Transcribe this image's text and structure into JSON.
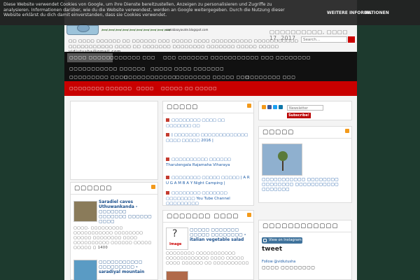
{
  "cookie": {
    "text": "Diese Website verwendet Cookies von Google, um ihre Dienste bereitzustellen, Anzeigen zu personalisieren und Zugriffe zu analysieren. Informationen darüber, wie du die Website verwendest, werden an Google weitergegeben. Durch die Nutzung dieser Website erklärst du dich damit einverstanden, dass sie Cookies verwendet.",
    "more_label": "WEITERE INFORMATIONEN",
    "ok_label": "OK"
  },
  "header": {
    "blog_title": "ꟷꟷꟷꟷꟷꟷꟷꟷꟷꟷ",
    "blog_url": "samabaayavate.blogspot.com",
    "date": "▢▢▢▢▢▢▢▢▢▢, ▢▢▢▢ 17, 2017",
    "search_placeholder": "Search...",
    "tagline": "▢▢ ▢▢▢▢ ▢▢▢▢▢▢ ▢▢ ▢▢▢▢▢▢ ▢▢▢ ▢▢▢▢▢ ▢▢▢▢ ▢▢▢▢▢▢▢▢▢▢ ▢▢▢▢▢▢▢▢▢▢▢ ▢▢▢▢▢▢▢▢▢▢▢ ▢▢▢▢ ▢▢ ▢▢▢▢▢▢▢ ▢▢▢▢▢▢▢▢ ▢▢▢▢▢▢▢ ▢▢▢▢▢ ▢▢▢▢▢ vidiutusha@gmail.com"
  },
  "nav": {
    "row1": [
      "▢▢▢▢ ▢▢▢▢▢",
      "▢▢▢▢▢▢▢ ▢▢▢",
      "▢▢▢ ▢▢▢▢▢▢▢ ▢▢▢▢▢▢▢",
      "▢▢▢▢ ▢▢▢ ▢▢▢▢▢▢▢▢"
    ],
    "row2": [
      "▢▢▢▢▢▢▢▢▢▢▢ ▢▢▢▢▢▢",
      "▢▢▢▢▢ ▢▢▢▢ ▢▢▢▢▢▢▢"
    ],
    "row3": [
      "▢▢▢▢▢▢▢▢▢ ▢▢▢▢",
      "▢▢▢▢▢▢▢▢▢▢▢▢",
      "▢▢▢▢▢▢▢▢ ▢▢▢▢▢ ▢▢▢",
      "▢▢▢▢▢▢▢▢ ▢▢▢"
    ],
    "row4": [
      "▢▢▢▢▢▢▢▢",
      "▢▢▢▢▢▢",
      "▢▢▢▢",
      "▢▢▢▢▢ ▢▢ ▢▢▢▢▢"
    ]
  },
  "left": {
    "heading": "▢▢▢▢▢▢",
    "posts": [
      {
        "title": "Saradiel caves Uthuwankanda - ▢▢▢▢▢▢▢ ▢▢▢▢▢▢▢ ▢▢▢▢▢▢ ▢▢▢▢",
        "text": "▢▢▢▢. ▢▢▢▢▢▢▢▢▢ ▢▢▢▢▢▢▢▢▢▢▢ ▢▢▢▢▢▢▢▢ ▢▢▢▢▢ ▢▢▢▢▢▢▢▢ ▢▢▢▢ ▢▢▢▢▢▢▢▢▢▢ ▢▢▢▢▢▢ ▢▢▢▢▢ ▢▢▢▢▢ ▢ 1400"
      },
      {
        "title": "▢▢▢▢▢▢▢▢▢▢▢ ▢▢▢▢▢▢▢▢▢ - saradiyal mountain",
        "text": ""
      }
    ]
  },
  "middle": {
    "heading": "▢▢▢▢▢",
    "items": [
      "▢▢▢▢▢▢▢▢ ▢▢▢▢ ▢▢ ▢▢▢▢▢▢▢ ▢▢",
      "| ▢▢▢▢▢▢▢ ▢▢▢▢▢▢▢▢▢▢▢▢▢ ▢▢▢▢ ▢▢▢▢▢ 2016 |",
      "▢▢▢▢▢▢▢▢▢▢ ▢▢▢▢▢▢ Tharulengala Rajamaha Viharaya",
      "▢▢▢▢▢▢▢▢ ▢▢▢▢▢ ▢▢▢▢▢ | A R U G A M B A Y Night Camping |",
      "▢▢▢▢▢▢▢▢ ▢▢▢▢▢▢▢ ▢▢▢▢▢▢▢▢ You Tube Channel ▢▢▢▢▢▢▢▢▢"
    ],
    "heading2": "▢▢▢▢▢▢▢ ▢▢▢▢",
    "post": {
      "title": "▢▢▢▢▢ ▢▢▢▢▢▢▢ ▢▢▢▢▢ ▢▢▢▢▢▢▢▢ - italian vegetable salad",
      "text": "▢▢▢▢▢▢▢▢ ▢▢▢▢▢▢▢▢▢▢▢ ▢▢▢▢▢▢▢▢▢▢▢▢ ▢▢▢▢ ▢▢▢▢▢ ▢▢▢▢ ▢▢▢▢▢▢ ▢▢ ▢▢▢▢▢▢▢▢▢▢"
    },
    "thumb_label": "Image"
  },
  "right": {
    "newsletter_placeholder": "Newsletter",
    "subscribe_label": "Subscribe!",
    "heading": "▢▢▢▢▢",
    "book_caption": "▢▢▢▢▢▢▢▢▢▢▢ ▢▢▢▢▢▢▢▢ ▢▢▢▢▢▢▢▢ ▢▢▢▢▢▢▢▢▢▢▢ ▢▢▢▢▢▢▢",
    "heading2": "▢▢▢▢▢▢▢▢▢▢▢▢",
    "instagram_label": "View on Instagram",
    "tweet_title": "tweet",
    "follow_text": "Follow @vidiutusha",
    "follow_tail": "▢▢▢▢ ▢▢▢▢▢▢▢▢"
  },
  "colors": {
    "background": "#1d3a2e",
    "nav_dark": "#111111",
    "nav_red": "#c90000",
    "link": "#1a5aa6",
    "bullet": "#c43b2f"
  }
}
